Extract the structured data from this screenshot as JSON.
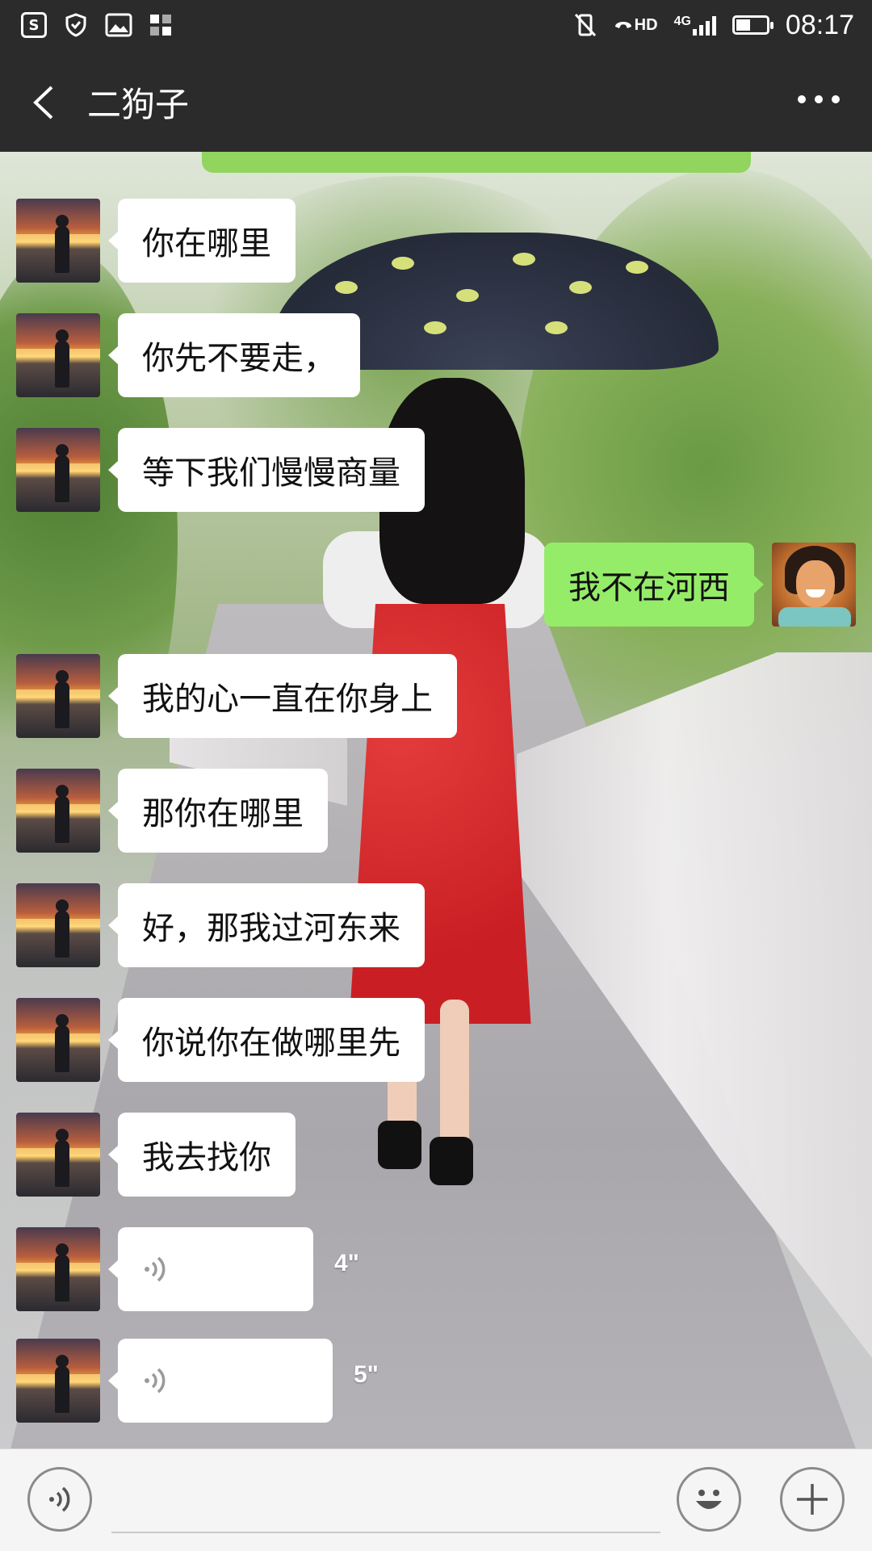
{
  "status_bar": {
    "time": "08:17",
    "network_label": "4G",
    "hd_label": "HD",
    "battery_level": 0.45,
    "icons": [
      "app-s-icon",
      "shield-icon",
      "gallery-icon",
      "apps-icon",
      "vibrate-off-icon",
      "hd-call-icon",
      "signal-icon",
      "battery-icon"
    ]
  },
  "header": {
    "title": "二狗子",
    "back_icon": "chevron-left-icon",
    "more_icon": "more-dots-icon"
  },
  "messages": [
    {
      "side": "left",
      "type": "text",
      "text": "你在哪里"
    },
    {
      "side": "left",
      "type": "text",
      "text": "你先不要走，"
    },
    {
      "side": "left",
      "type": "text",
      "text": "等下我们慢慢商量"
    },
    {
      "side": "right",
      "type": "text",
      "text": "我不在河西"
    },
    {
      "side": "left",
      "type": "text",
      "text": "我的心一直在你身上"
    },
    {
      "side": "left",
      "type": "text",
      "text": "那你在哪里"
    },
    {
      "side": "left",
      "type": "text",
      "text": "好，那我过河东来"
    },
    {
      "side": "left",
      "type": "text",
      "text": "你说你在做哪里先"
    },
    {
      "side": "left",
      "type": "text",
      "text": "我去找你"
    },
    {
      "side": "left",
      "type": "voice",
      "duration": "4\""
    },
    {
      "side": "left",
      "type": "voice",
      "duration": "5\""
    }
  ],
  "input_bar": {
    "voice_icon": "voice-mode-icon",
    "emoji_icon": "emoji-icon",
    "plus_icon": "plus-icon",
    "text_value": ""
  },
  "colors": {
    "bar_dark": "#2b2b2b",
    "bubble_self": "#95ec69",
    "bubble_other": "#ffffff",
    "input_bg": "#f5f5f6"
  }
}
